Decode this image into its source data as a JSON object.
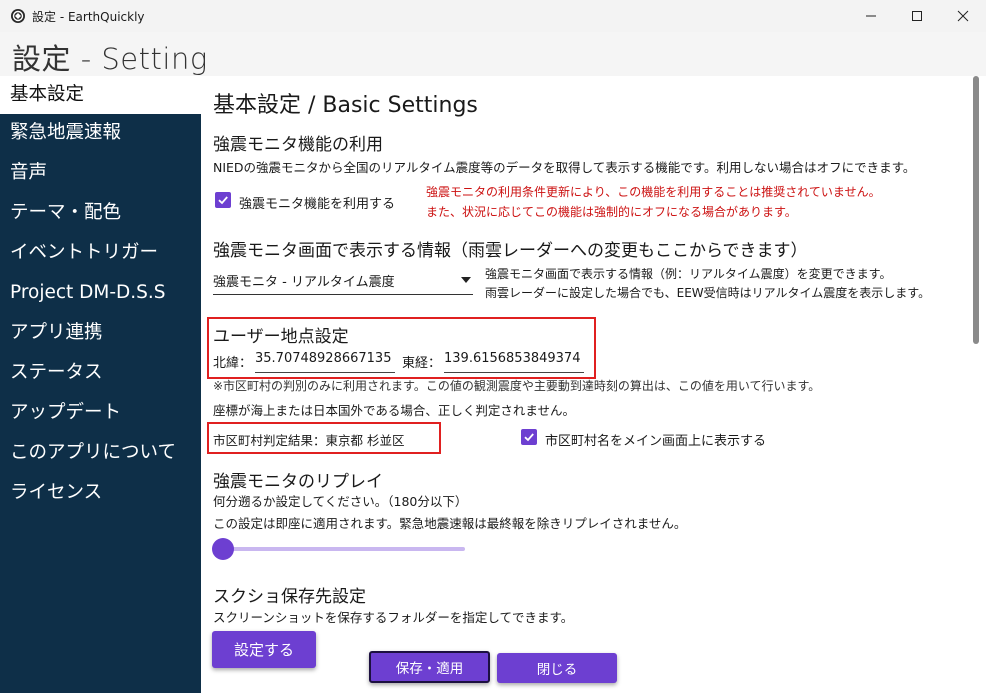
{
  "window": {
    "title": "設定 - EarthQuickly",
    "icon": "app-logo-icon"
  },
  "header": {
    "title": "設定 - Setting"
  },
  "sidebar": {
    "items": [
      {
        "label": "基本設定",
        "active": true
      },
      {
        "label": "緊急地震速報"
      },
      {
        "label": "音声"
      },
      {
        "label": "テーマ・配色"
      },
      {
        "label": "イベントトリガー"
      },
      {
        "label": "Project DM-D.S.S"
      },
      {
        "label": "アプリ連携"
      },
      {
        "label": "ステータス"
      },
      {
        "label": "アップデート"
      },
      {
        "label": "このアプリについて"
      },
      {
        "label": "ライセンス"
      }
    ]
  },
  "main": {
    "title": "基本設定 / Basic Settings",
    "monitor": {
      "heading": "強震モニタ機能の利用",
      "description": "NIEDの強震モニタから全国のリアルタイム震度等のデータを取得して表示する機能です。利用しない場合はオフにできます。",
      "checkbox_label": "強震モニタ機能を利用する",
      "checked": true,
      "warning_line1": "強震モニタの利用条件更新により、この機能を利用することは推奨されていません。",
      "warning_line2": "また、状況に応じてこの機能は強制的にオフになる場合があります。"
    },
    "display_info": {
      "heading": "強震モニタ画面で表示する情報（雨雲レーダーへの変更もここからできます）",
      "selected": "強震モニタ - リアルタイム震度",
      "desc_line1": "強震モニタ画面で表示する情報（例：リアルタイム震度）を変更できます。",
      "desc_line2": "雨雲レーダーに設定した場合でも、EEW受信時はリアルタイム震度を表示します。"
    },
    "user_location": {
      "heading": "ユーザー地点設定",
      "lat_label": "北緯：",
      "lat_value": "35.70748928667135",
      "lon_label": "東経：",
      "lon_value": "139.6156853849374",
      "note_line1": "※市区町村の判別のみに利用されます。この値の観測震度や主要動到達時刻の算出は、この値を用いて行います。",
      "note_line2": "座標が海上または日本国外である場合、正しく判定されません。",
      "result_label": "市区町村判定結果：東京都 杉並区",
      "show_checkbox_label": "市区町村名をメイン画面上に表示する",
      "show_checked": true
    },
    "replay": {
      "heading": "強震モニタのリプレイ",
      "desc_line1": "何分遡るか設定してください。（180分以下）",
      "desc_line2": "この設定は即座に適用されます。緊急地震速報は最終報を除きリプレイされません。",
      "slider_value": 0
    },
    "screenshot": {
      "heading": "スクショ保存先設定",
      "description": "スクリーンショットを保存するフォルダーを指定してできます。",
      "button_label": "設定する"
    }
  },
  "footer": {
    "save_label": "保存・適用",
    "close_label": "閉じる"
  },
  "colors": {
    "accent": "#6d3fd1",
    "sidebar_bg": "#0e2f48",
    "warning": "#cc1111",
    "highlight_box": "#e02020"
  }
}
